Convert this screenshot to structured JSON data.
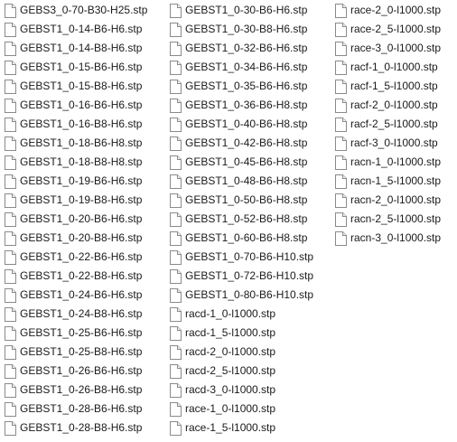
{
  "files": {
    "icon": "blank-file-icon",
    "columns": [
      [
        "GEBS3_0-70-B30-H25.stp",
        "GEBST1_0-14-B6-H6.stp",
        "GEBST1_0-14-B8-H6.stp",
        "GEBST1_0-15-B6-H6.stp",
        "GEBST1_0-15-B8-H6.stp",
        "GEBST1_0-16-B6-H6.stp",
        "GEBST1_0-16-B8-H6.stp",
        "GEBST1_0-18-B6-H8.stp",
        "GEBST1_0-18-B8-H8.stp",
        "GEBST1_0-19-B6-H6.stp",
        "GEBST1_0-19-B8-H6.stp",
        "GEBST1_0-20-B6-H6.stp",
        "GEBST1_0-20-B8-H6.stp",
        "GEBST1_0-22-B6-H6.stp",
        "GEBST1_0-22-B8-H6.stp",
        "GEBST1_0-24-B6-H6.stp",
        "GEBST1_0-24-B8-H6.stp",
        "GEBST1_0-25-B6-H6.stp",
        "GEBST1_0-25-B8-H6.stp",
        "GEBST1_0-26-B6-H6.stp",
        "GEBST1_0-26-B8-H6.stp",
        "GEBST1_0-28-B6-H6.stp",
        "GEBST1_0-28-B8-H6.stp"
      ],
      [
        "GEBST1_0-30-B6-H6.stp",
        "GEBST1_0-30-B8-H6.stp",
        "GEBST1_0-32-B6-H6.stp",
        "GEBST1_0-34-B6-H6.stp",
        "GEBST1_0-35-B6-H6.stp",
        "GEBST1_0-36-B6-H8.stp",
        "GEBST1_0-40-B6-H8.stp",
        "GEBST1_0-42-B6-H8.stp",
        "GEBST1_0-45-B6-H8.stp",
        "GEBST1_0-48-B6-H8.stp",
        "GEBST1_0-50-B6-H8.stp",
        "GEBST1_0-52-B6-H8.stp",
        "GEBST1_0-60-B6-H8.stp",
        "GEBST1_0-70-B6-H10.stp",
        "GEBST1_0-72-B6-H10.stp",
        "GEBST1_0-80-B6-H10.stp",
        "racd-1_0-l1000.stp",
        "racd-1_5-l1000.stp",
        "racd-2_0-l1000.stp",
        "racd-2_5-l1000.stp",
        "racd-3_0-l1000.stp",
        "race-1_0-l1000.stp",
        "race-1_5-l1000.stp"
      ],
      [
        "race-2_0-l1000.stp",
        "race-2_5-l1000.stp",
        "race-3_0-l1000.stp",
        "racf-1_0-l1000.stp",
        "racf-1_5-l1000.stp",
        "racf-2_0-l1000.stp",
        "racf-2_5-l1000.stp",
        "racf-3_0-l1000.stp",
        "racn-1_0-l1000.stp",
        "racn-1_5-l1000.stp",
        "racn-2_0-l1000.stp",
        "racn-2_5-l1000.stp",
        "racn-3_0-l1000.stp"
      ]
    ]
  }
}
